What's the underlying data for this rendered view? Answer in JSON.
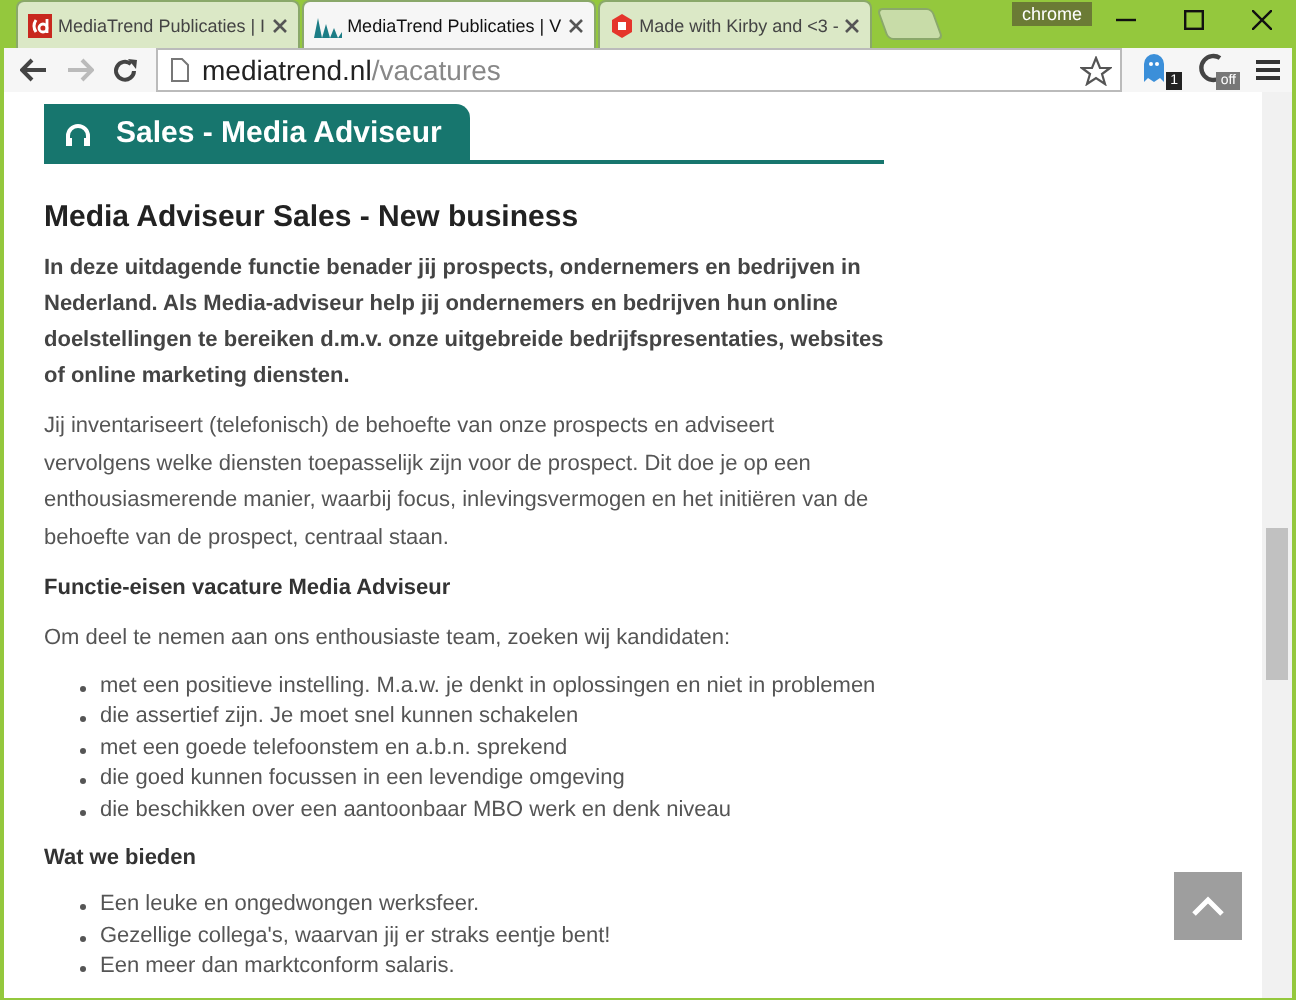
{
  "window": {
    "badge": "chrome"
  },
  "tabs": [
    {
      "title": "MediaTrend Publicaties | I",
      "selected": false,
      "kind": "red-square"
    },
    {
      "title": "MediaTrend Publicaties | V",
      "selected": true,
      "kind": "teal-chart"
    },
    {
      "title": "Made with Kirby and <3 -",
      "selected": false,
      "kind": "red-hexagon"
    }
  ],
  "navigation": {
    "back_disabled": false,
    "forward_disabled": true
  },
  "address": {
    "host": "mediatrend.nl",
    "path": "/vacatures"
  },
  "extensions": [
    {
      "kind": "ghost",
      "badge": "1"
    },
    {
      "kind": "cookie",
      "badge": "off"
    }
  ],
  "page": {
    "section_title": "Sales - Media Adviseur",
    "heading": "Media Adviseur Sales - New business",
    "intro": "In deze uitdagende functie benader jij prospects, ondernemers en bedrijven in Nederland. Als Media-adviseur help jij ondernemers en bedrijven hun online doelstellingen te bereiken d.m.v. onze uitgebreide bedrijfspresentaties, websites of online marketing diensten.",
    "paragraph": "Jij inventariseert (telefonisch) de behoefte van onze prospects en adviseert vervolgens welke diensten toepasselijk zijn voor de prospect. Dit doe je op een enthousiasmerende manier, waarbij focus, inlevingsvermogen en het initiëren van de behoefte van de prospect, centraal staan.",
    "requirements_heading": "Functie-eisen vacature Media Adviseur",
    "requirements_intro": "Om deel te nemen aan ons enthousiaste team, zoeken wij kandidaten:",
    "requirements": [
      "met een positieve instelling. M.a.w. je denkt in oplossingen en niet in problemen",
      "die assertief zijn. Je moet snel kunnen schakelen",
      "met een goede telefoonstem en a.b.n. sprekend",
      "die goed kunnen focussen in een levendige omgeving",
      "die beschikken over een aantoonbaar MBO werk en denk niveau"
    ],
    "offer_heading": "Wat we bieden",
    "offer": [
      "Een leuke en ongedwongen werksfeer.",
      "Gezellige collega's, waarvan jij er straks eentje bent!",
      "Een meer dan marktconform salaris."
    ]
  }
}
